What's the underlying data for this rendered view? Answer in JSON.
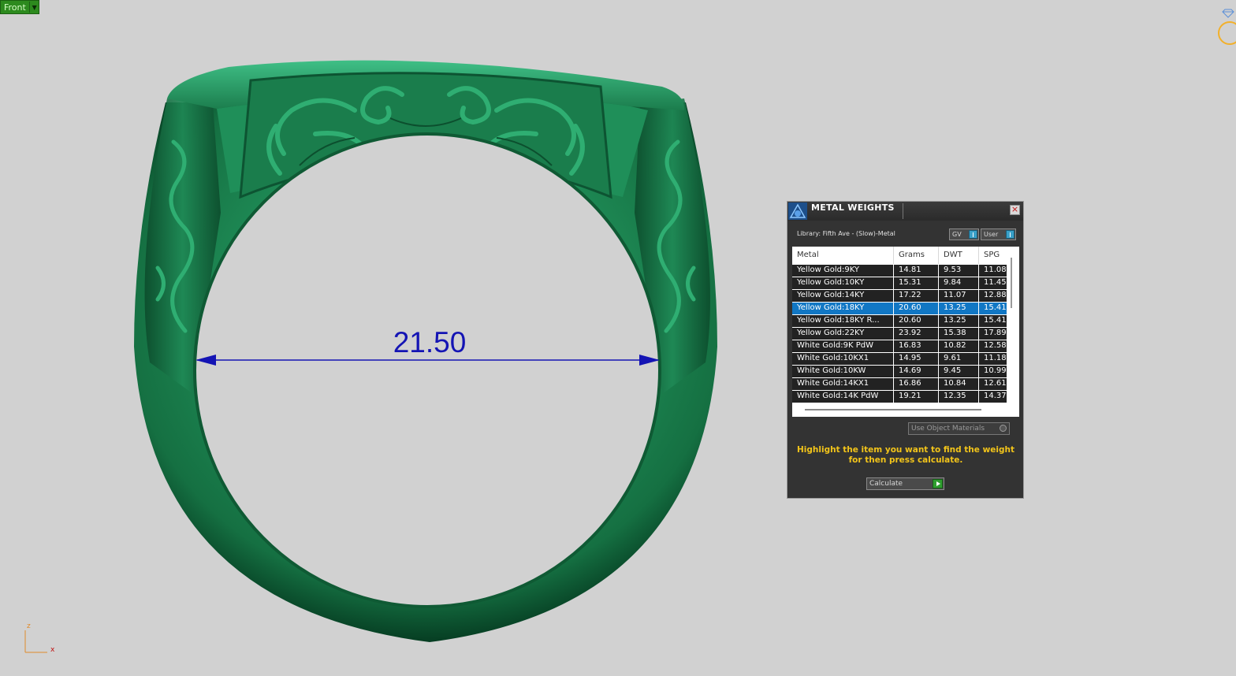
{
  "viewport": {
    "view_name": "Front",
    "dimension_label": "21.50",
    "axis": {
      "z_label": "z",
      "x_label": "x"
    },
    "colors": {
      "background": "#d1d1d1",
      "ring": "#1f7a4c",
      "dimension": "#1414b4",
      "nav_ring": "#f2b02a"
    }
  },
  "panel": {
    "title": "METAL WEIGHTS",
    "close_label": "×",
    "library": "Library: Fifth Ave - (Slow)-Metal",
    "gv_label": "GV",
    "user_label": "User",
    "columns": [
      "Metal",
      "Grams",
      "DWT",
      "SPG"
    ],
    "rows": [
      [
        "Yellow Gold:9KY",
        "14.81",
        "9.53",
        "11.08"
      ],
      [
        "Yellow Gold:10KY",
        "15.31",
        "9.84",
        "11.45"
      ],
      [
        "Yellow Gold:14KY",
        "17.22",
        "11.07",
        "12.88"
      ],
      [
        "Yellow Gold:18KY",
        "20.60",
        "13.25",
        "15.41"
      ],
      [
        "Yellow Gold:18KY R...",
        "20.60",
        "13.25",
        "15.41"
      ],
      [
        "Yellow Gold:22KY",
        "23.92",
        "15.38",
        "17.89"
      ],
      [
        "White Gold:9K PdW",
        "16.83",
        "10.82",
        "12.58"
      ],
      [
        "White Gold:10KX1",
        "14.95",
        "9.61",
        "11.18"
      ],
      [
        "White Gold:10KW",
        "14.69",
        "9.45",
        "10.99"
      ],
      [
        "White Gold:14KX1",
        "16.86",
        "10.84",
        "12.61"
      ],
      [
        "White Gold:14K PdW",
        "19.21",
        "12.35",
        "14.37"
      ]
    ],
    "selected_row": "Yellow Gold:18KY",
    "use_object_materials": "Use Object Materials",
    "instruction": "Highlight the item you want to find the weight for then press calculate.",
    "calculate_label": "Calculate",
    "colors": {
      "panel": "#333333",
      "selection": "#1177c4",
      "instruction": "#f2c41a"
    }
  }
}
